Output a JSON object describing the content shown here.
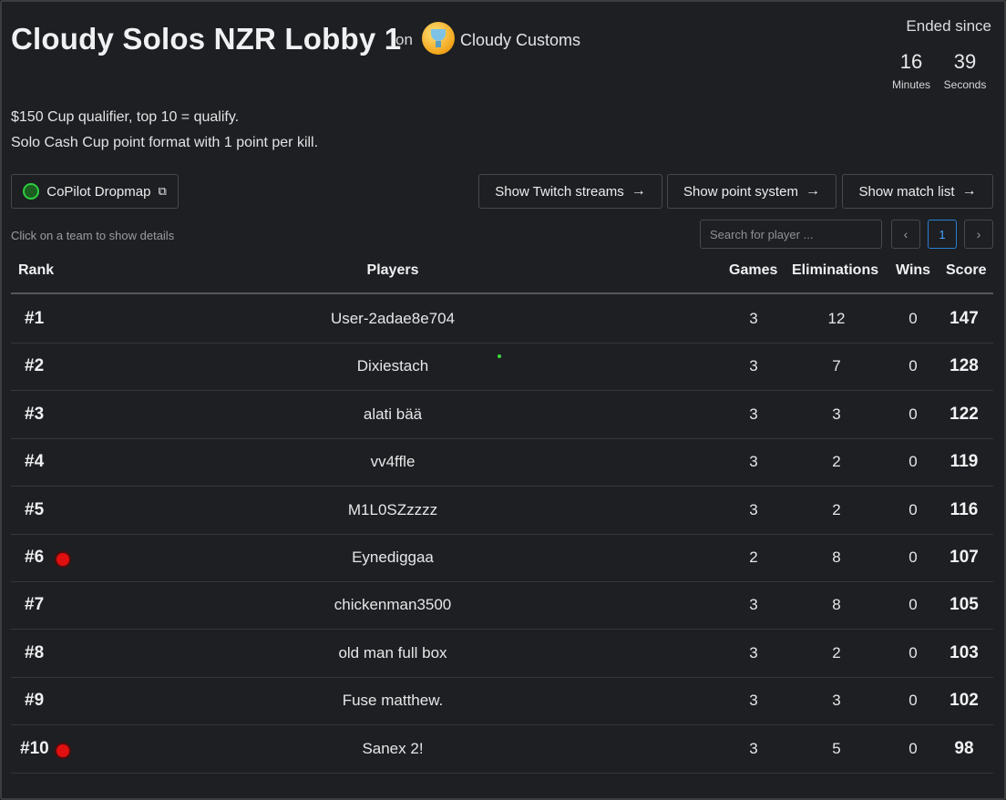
{
  "header": {
    "title": "Cloudy Solos NZR Lobby 1",
    "on_label": "on",
    "organizer": "Cloudy Customs",
    "ended_label": "Ended since",
    "timer": {
      "minutes_value": "16",
      "minutes_label": "Minutes",
      "seconds_value": "39",
      "seconds_label": "Seconds"
    }
  },
  "description": {
    "line1": "$150 Cup qualifier, top 10 = qualify.",
    "line2": "Solo Cash Cup point format with 1 point per kill."
  },
  "toolbar": {
    "dropmap_label": "CoPilot Dropmap",
    "twitch_label": "Show Twitch streams",
    "points_label": "Show point system",
    "matches_label": "Show match list"
  },
  "hint": "Click on a team to show details",
  "search": {
    "placeholder": "Search for player ..."
  },
  "pagination": {
    "prev": "‹",
    "current": "1",
    "next": "›"
  },
  "table": {
    "columns": {
      "rank": "Rank",
      "players": "Players",
      "games": "Games",
      "eliminations": "Eliminations",
      "wins": "Wins",
      "score": "Score"
    },
    "rows": [
      {
        "rank": "#1",
        "player": "User-2adae8e704",
        "games": "3",
        "eliminations": "12",
        "wins": "0",
        "score": "147",
        "live": false
      },
      {
        "rank": "#2",
        "player": "Dixiestach",
        "games": "3",
        "eliminations": "7",
        "wins": "0",
        "score": "128",
        "live": false
      },
      {
        "rank": "#3",
        "player": "alati bää",
        "games": "3",
        "eliminations": "3",
        "wins": "0",
        "score": "122",
        "live": false
      },
      {
        "rank": "#4",
        "player": "vv4ffle",
        "games": "3",
        "eliminations": "2",
        "wins": "0",
        "score": "119",
        "live": false
      },
      {
        "rank": "#5",
        "player": "M1L0SZzzzz",
        "games": "3",
        "eliminations": "2",
        "wins": "0",
        "score": "116",
        "live": false
      },
      {
        "rank": "#6",
        "player": "Eynediggaa",
        "games": "2",
        "eliminations": "8",
        "wins": "0",
        "score": "107",
        "live": true
      },
      {
        "rank": "#7",
        "player": "chickenman3500",
        "games": "3",
        "eliminations": "8",
        "wins": "0",
        "score": "105",
        "live": false
      },
      {
        "rank": "#8",
        "player": "old man full box",
        "games": "3",
        "eliminations": "2",
        "wins": "0",
        "score": "103",
        "live": false
      },
      {
        "rank": "#9",
        "player": "Fuse matthew.",
        "games": "3",
        "eliminations": "3",
        "wins": "0",
        "score": "102",
        "live": false
      },
      {
        "rank": "#10",
        "player": "Sanex 2!",
        "games": "3",
        "eliminations": "5",
        "wins": "0",
        "score": "98",
        "live": true
      }
    ]
  },
  "icons": {
    "org_logo": "trophy-logo-icon",
    "dropmap": "copilot-logo-icon",
    "external": "external-link-icon",
    "arrow": "arrow-right-icon",
    "live": "live-indicator-icon"
  },
  "colors": {
    "background": "#1d1f22",
    "accent": "#2a7fd4",
    "live": "#e01010"
  }
}
